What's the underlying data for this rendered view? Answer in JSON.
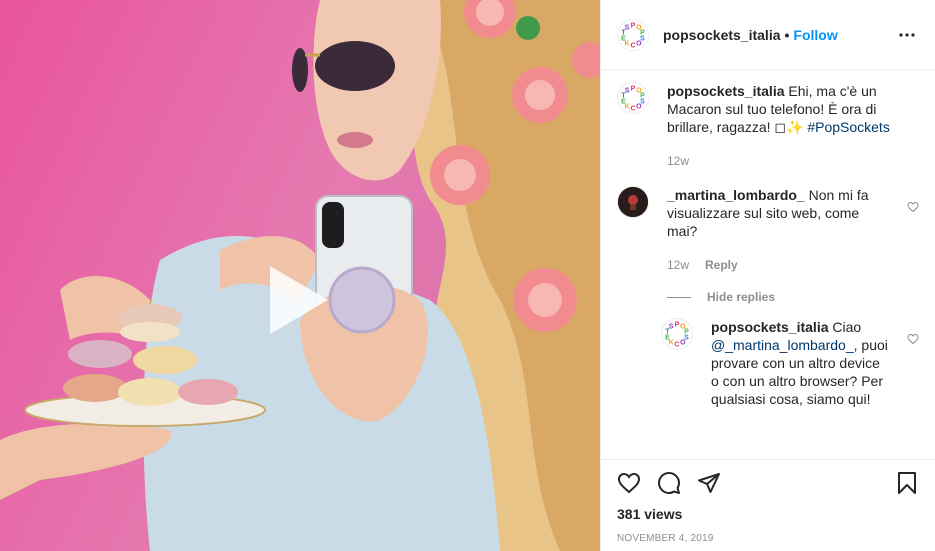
{
  "account": {
    "handle": "popsockets_italia",
    "separator": "•",
    "follow_label": "Follow"
  },
  "logo_letters": [
    "P",
    "O",
    "P",
    "S",
    "O",
    "C",
    "K",
    "E",
    "T",
    "S"
  ],
  "logo_colors": [
    "#e52e71",
    "#f3a21b",
    "#46b64a",
    "#2b7de0",
    "#8a3ab9",
    "#e52e71",
    "#f3a21b",
    "#46b64a",
    "#2b7de0",
    "#8a3ab9"
  ],
  "caption": {
    "author": "popsockets_italia",
    "text": "Ehi, ma c'è un Macaron sul tuo telefono! È ora di brillare, ragazza! ◻✨",
    "hashtag": "#PopSockets",
    "time": "12w"
  },
  "comment": {
    "author": "_martina_lombardo_",
    "text": "Non mi fa visualizzare sul sito web, come mai?",
    "time": "12w",
    "reply_label": "Reply",
    "hide_replies_label": "Hide replies"
  },
  "reply": {
    "author": "popsockets_italia",
    "text_before": "Ciao",
    "mention": "@_martina_lombardo_",
    "text_after": ", puoi provare con un altro device o con un altro browser? Per qualsiasi cosa, siamo qui!"
  },
  "stats": {
    "views": "381 views",
    "date": "NOVEMBER 4, 2019"
  },
  "icons": {
    "play": "play-icon",
    "more": "more-options-icon",
    "like": "heart-icon",
    "comment": "comment-icon",
    "share": "share-icon",
    "save": "bookmark-icon"
  }
}
